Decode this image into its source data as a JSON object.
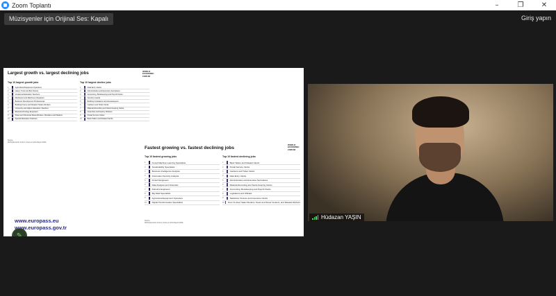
{
  "window": {
    "title": "Zoom Toplantı",
    "controls": [
      "–",
      "❐",
      "✕"
    ]
  },
  "toolbar": {
    "original_audio": "Müzisyenler için Orijinal Ses: Kapalı",
    "signin": "Giriş yapın"
  },
  "shared_screen": {
    "slide1": {
      "title": "Largest growth vs. largest declining jobs",
      "logo": "WORLD ECONOMIC FORUM",
      "left_heading": "Top 10 largest growth jobs",
      "left_items": [
        "Agricultural Equipment Operators",
        "Heavy Truck and Bus Drivers",
        "Vocational Education Teachers",
        "Mechanics and Machinery Repairers",
        "Business Development Professionals",
        "Building Frame and Related Trades Workers",
        "University and Higher Education Teachers",
        "Electrotechnology Engineers",
        "Sheet and Structural Metal Workers, Moulders and Welders",
        "Special Education Teachers"
      ],
      "right_heading": "Top 10 largest decline jobs",
      "right_items": [
        "Data Entry Clerks",
        "Administrative and Executive Secretaries",
        "Accounting, Bookkeeping and Payroll Clerks",
        "Security Guards",
        "Building Caretakers and Housekeepers",
        "Cashiers and Ticket Clerks",
        "Material-Recording and Stock-Keeping Clerks",
        "Assembly and Factory Workers",
        "Postal Service Clerks",
        "Bank Tellers and Related Clerks"
      ],
      "source": "Source\nWorld Economic Forum, Future of Jobs Report 2023."
    },
    "slide2": {
      "title": "Fastest growing vs. fastest declining jobs",
      "logo": "WORLD ECONOMIC FORUM",
      "left_heading": "Top 10 fastest growing jobs",
      "left_items": [
        "AI and Machine Learning Specialists",
        "Sustainability Specialists",
        "Business Intelligence Analysts",
        "Information Security Analysts",
        "Fintech Engineers",
        "Data Analysts and Scientists",
        "Robotics Engineers",
        "Big Data Specialists",
        "Agricultural Equipment Operators",
        "Digital Transformation Specialists"
      ],
      "right_heading": "Top 10 fastest declining jobs",
      "right_items": [
        "Bank Tellers and Related Clerks",
        "Postal Service Clerks",
        "Cashiers and Ticket Clerks",
        "Data Entry Clerks",
        "Administrative and Executive Secretaries",
        "Material-Recording and Stock-Keeping Clerks",
        "Accounting, Bookkeeping and Payroll Clerks",
        "Legislators and Officials",
        "Statistical, Finance and Insurance Clerks",
        "Door-To-Door Sales Workers, News and Street Vendors, and Related Workers"
      ],
      "source": "Source\nWorld Economic Forum, Future of Jobs Report 2023."
    },
    "europass": [
      "www.europass.eu",
      "www.europass.gov.tr"
    ]
  },
  "participant": {
    "name": "Hüdazan YAŞIN"
  }
}
